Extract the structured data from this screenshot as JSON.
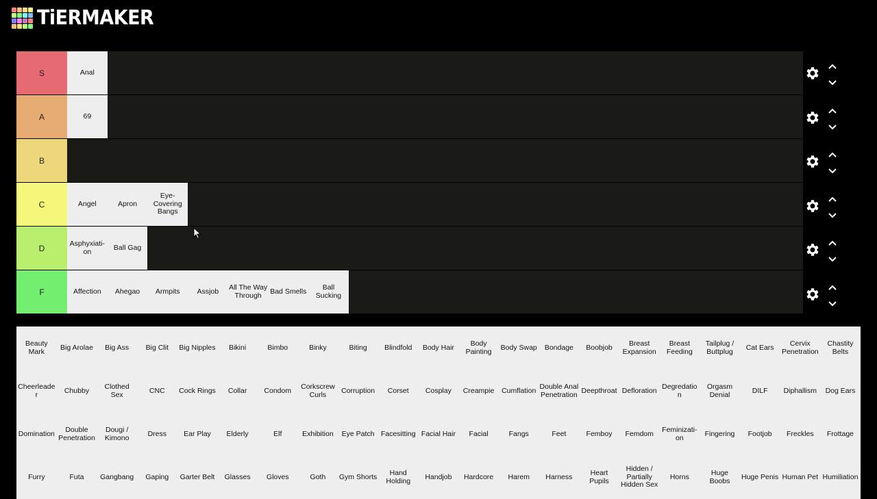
{
  "app": {
    "title": "TiERMAKER",
    "logo_colors": [
      "#ff7f7f",
      "#ffbf7f",
      "#ffdf7f",
      "#ffff7f",
      "#bfff7f",
      "#7fff7f",
      "#7fffff",
      "#7fbfff",
      "#7f7fff",
      "#ff7fff",
      "#bf7fbf",
      "#ff7f7f",
      "#ffbf7f",
      "#ffdf7f",
      "#bfff7f",
      "#7fff7f"
    ]
  },
  "tiers": [
    {
      "label": "S",
      "color": "#e56a72",
      "items": [
        "Anal"
      ]
    },
    {
      "label": "A",
      "color": "#e8ac73",
      "items": [
        "69"
      ]
    },
    {
      "label": "B",
      "color": "#edd57a",
      "items": []
    },
    {
      "label": "C",
      "color": "#f4f779",
      "items": [
        "Angel",
        "Apron",
        "Eye-Covering Bangs"
      ]
    },
    {
      "label": "D",
      "color": "#b8f06e",
      "items": [
        "Asphyxiati-on",
        "Ball Gag"
      ]
    },
    {
      "label": "F",
      "color": "#74ee70",
      "items": [
        "Affection",
        "Ahegao",
        "Armpits",
        "Assjob",
        "All The Way Through",
        "Bad Smells",
        "Ball Sucking"
      ]
    }
  ],
  "controls": {
    "gear_icon": "gear-icon",
    "up_icon": "chevron-up-icon",
    "down_icon": "chevron-down-icon"
  },
  "pool": [
    "Beauty Mark",
    "Big Arolae",
    "Big Ass",
    "Big Clit",
    "Big Nipples",
    "Bikini",
    "Bimbo",
    "Binky",
    "Biting",
    "Blindfold",
    "Body Hair",
    "Body Painting",
    "Body Swap",
    "Bondage",
    "Boobjob",
    "Breast Expansion",
    "Breast Feeding",
    "Tailplug / Buttplug",
    "Cat Ears",
    "Cervix Penetration",
    "Chastity Belts",
    "Cheerleader",
    "Chubby",
    "Clothed Sex",
    "CNC",
    "Cock Rings",
    "Collar",
    "Condom",
    "Corkscrew Curls",
    "Corruption",
    "Corset",
    "Cosplay",
    "Creampie",
    "Cumflation",
    "Double Anal Penetration",
    "Deepthroat",
    "Defloration",
    "Degredation",
    "Orgasm Denial",
    "DILF",
    "Diphallism",
    "Dog Ears",
    "Domination",
    "Double Penetration",
    "Dougi / Kimono",
    "Dress",
    "Ear Play",
    "Elderly",
    "Elf",
    "Exhibition",
    "Eye Patch",
    "Facesitting",
    "Facial Hair",
    "Facial",
    "Fangs",
    "Feet",
    "Femboy",
    "Femdom",
    "Feminizati-on",
    "Fingering",
    "Footjob",
    "Freckles",
    "Frottage",
    "Furry",
    "Futa",
    "Gangbang",
    "Gaping",
    "Garter Belt",
    "Glasses",
    "Gloves",
    "Goth",
    "Gym Shorts",
    "Hand Holding",
    "Handjob",
    "Hardcore",
    "Harem",
    "Harness",
    "Heart Pupils",
    "Hidden / Partially Hidden Sex",
    "Horns",
    "Huge Boobs",
    "Huge Penis",
    "Human Pet",
    "Humiliation"
  ]
}
